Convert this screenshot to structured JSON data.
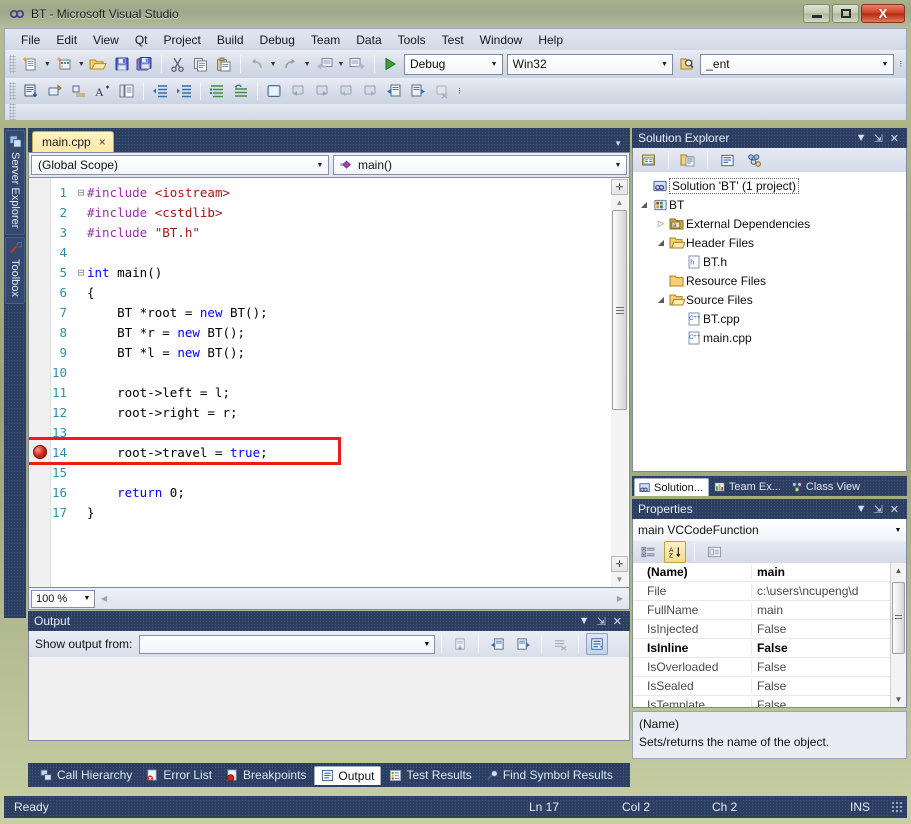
{
  "window": {
    "title": "BT - Microsoft Visual Studio",
    "app_icon": "visual-studio-icon",
    "minimize_label": "Minimize",
    "maximize_label": "Maximize",
    "close_label": "X"
  },
  "menu": {
    "items": [
      {
        "label": "File",
        "accel": "F"
      },
      {
        "label": "Edit",
        "accel": "E"
      },
      {
        "label": "View",
        "accel": "V"
      },
      {
        "label": "Qt",
        "accel": "Q"
      },
      {
        "label": "Project",
        "accel": "P"
      },
      {
        "label": "Build",
        "accel": "B"
      },
      {
        "label": "Debug",
        "accel": "D"
      },
      {
        "label": "Team",
        "accel": "m"
      },
      {
        "label": "Data",
        "accel": "a"
      },
      {
        "label": "Tools",
        "accel": "T"
      },
      {
        "label": "Test",
        "accel": "s"
      },
      {
        "label": "Window",
        "accel": "W"
      },
      {
        "label": "Help",
        "accel": "H"
      }
    ]
  },
  "toolbar": {
    "config_value": "Debug",
    "platform_value": "Win32",
    "find_value": "_ent",
    "start_label": "Start Debugging",
    "buttons": [
      "new-project-icon",
      "add-new-item-icon",
      "open-file-icon",
      "save-icon",
      "save-all-icon",
      "cut-icon",
      "copy-icon",
      "paste-icon",
      "undo-icon",
      "redo-icon",
      "navigate-backward-icon",
      "navigate-forward-icon"
    ],
    "text_editor_buttons": [
      "display-hidden-icon",
      "toggle-word-wrap-icon",
      "toggle-whitespace-icon",
      "font-size-icon",
      "clipboard-ring-icon",
      "decrease-indent-icon",
      "increase-indent-icon",
      "comment-lines-icon",
      "uncomment-lines-icon",
      "toggle-bookmark-icon",
      "previous-bookmark-icon",
      "next-bookmark-icon",
      "previous-bookmark-folder-icon",
      "next-bookmark-folder-icon",
      "move-bookmark-prev-icon",
      "move-bookmark-next-icon",
      "clear-bookmarks-icon"
    ]
  },
  "left_dock": {
    "tabs": [
      {
        "label": "Server Explorer",
        "icon": "server-explorer-icon"
      },
      {
        "label": "Toolbox",
        "icon": "toolbox-icon"
      }
    ]
  },
  "editor": {
    "tab_label": "main.cpp",
    "tab_close": "×",
    "scope_value": "(Global Scope)",
    "function_value": "main()",
    "function_icon": "method-icon",
    "zoom_value": "100 %",
    "breakpoint_line": 14,
    "highlight_line": 14,
    "lines": [
      {
        "n": "1",
        "fold": "−",
        "tokens": [
          {
            "t": "#include ",
            "c": "pre"
          },
          {
            "t": "<iostream>",
            "c": "ang"
          }
        ]
      },
      {
        "n": "2",
        "fold": "",
        "tokens": [
          {
            "t": "#include ",
            "c": "pre"
          },
          {
            "t": "<cstdlib>",
            "c": "ang"
          }
        ]
      },
      {
        "n": "3",
        "fold": "",
        "tokens": [
          {
            "t": "#include ",
            "c": "pre"
          },
          {
            "t": "\"BT.h\"",
            "c": "str"
          }
        ]
      },
      {
        "n": "4",
        "fold": "",
        "tokens": []
      },
      {
        "n": "5",
        "fold": "−",
        "tokens": [
          {
            "t": "int",
            "c": "kw"
          },
          {
            "t": " main()",
            "c": "ctext"
          }
        ]
      },
      {
        "n": "6",
        "fold": "",
        "tokens": [
          {
            "t": "{",
            "c": "ctext"
          }
        ]
      },
      {
        "n": "7",
        "fold": "",
        "tokens": [
          {
            "t": "    BT *root = ",
            "c": "ctext"
          },
          {
            "t": "new",
            "c": "kw"
          },
          {
            "t": " BT();",
            "c": "ctext"
          }
        ]
      },
      {
        "n": "8",
        "fold": "",
        "tokens": [
          {
            "t": "    BT *r = ",
            "c": "ctext"
          },
          {
            "t": "new",
            "c": "kw"
          },
          {
            "t": " BT();",
            "c": "ctext"
          }
        ]
      },
      {
        "n": "9",
        "fold": "",
        "tokens": [
          {
            "t": "    BT *l = ",
            "c": "ctext"
          },
          {
            "t": "new",
            "c": "kw"
          },
          {
            "t": " BT();",
            "c": "ctext"
          }
        ]
      },
      {
        "n": "10",
        "fold": "",
        "tokens": []
      },
      {
        "n": "11",
        "fold": "",
        "tokens": [
          {
            "t": "    root->left = l;",
            "c": "ctext"
          }
        ]
      },
      {
        "n": "12",
        "fold": "",
        "tokens": [
          {
            "t": "    root->right = r;",
            "c": "ctext"
          }
        ]
      },
      {
        "n": "13",
        "fold": "",
        "tokens": []
      },
      {
        "n": "14",
        "fold": "",
        "tokens": [
          {
            "t": "    root->travel = ",
            "c": "ctext"
          },
          {
            "t": "true",
            "c": "kw"
          },
          {
            "t": ";",
            "c": "ctext"
          }
        ]
      },
      {
        "n": "15",
        "fold": "",
        "tokens": []
      },
      {
        "n": "16",
        "fold": "",
        "tokens": [
          {
            "t": "    ",
            "c": "ctext"
          },
          {
            "t": "return",
            "c": "kw"
          },
          {
            "t": " 0;",
            "c": "ctext"
          }
        ]
      },
      {
        "n": "17",
        "fold": "",
        "tokens": [
          {
            "t": "}",
            "c": "ctext"
          }
        ]
      }
    ]
  },
  "output": {
    "title": "Output",
    "show_output_from_label": "Show output from:",
    "show_output_from_value": "",
    "body_text": "",
    "toolbar_buttons": [
      "find-message-icon",
      "go-to-previous-icon",
      "go-to-next-icon",
      "clear-all-icon",
      "toggle-word-wrap-icon"
    ],
    "tabs": [
      {
        "label": "Call Hierarchy",
        "icon": "call-hierarchy-icon",
        "active": false
      },
      {
        "label": "Error List",
        "icon": "error-list-icon",
        "active": false
      },
      {
        "label": "Breakpoints",
        "icon": "breakpoints-icon",
        "active": false
      },
      {
        "label": "Output",
        "icon": "output-icon",
        "active": true
      },
      {
        "label": "Test Results",
        "icon": "test-results-icon",
        "active": false
      },
      {
        "label": "Find Symbol Results",
        "icon": "find-symbol-results-icon",
        "active": false
      }
    ]
  },
  "solution_explorer": {
    "title": "Solution Explorer",
    "toolbar_buttons": [
      "properties-window-icon",
      "show-all-files-icon",
      "view-code-icon",
      "view-class-diagram-icon"
    ],
    "tree": [
      {
        "depth": 0,
        "arrow": "",
        "icon": "solution-icon",
        "label": "Solution 'BT' (1 project)",
        "selected": true
      },
      {
        "depth": 0,
        "arrow": "◢",
        "icon": "project-icon",
        "label": "BT",
        "selected": false
      },
      {
        "depth": 1,
        "arrow": "▷",
        "icon": "folder-ext-icon",
        "label": "External Dependencies",
        "selected": false
      },
      {
        "depth": 1,
        "arrow": "◢",
        "icon": "folder-open-icon",
        "label": "Header Files",
        "selected": false
      },
      {
        "depth": 2,
        "arrow": "",
        "icon": "header-file-icon",
        "label": "BT.h",
        "selected": false
      },
      {
        "depth": 1,
        "arrow": "",
        "icon": "folder-icon",
        "label": "Resource Files",
        "selected": false
      },
      {
        "depth": 1,
        "arrow": "◢",
        "icon": "folder-open-icon",
        "label": "Source Files",
        "selected": false
      },
      {
        "depth": 2,
        "arrow": "",
        "icon": "cpp-file-icon",
        "label": "BT.cpp",
        "selected": false
      },
      {
        "depth": 2,
        "arrow": "",
        "icon": "cpp-file-icon",
        "label": "main.cpp",
        "selected": false
      }
    ],
    "tabs": [
      {
        "label": "Solution...",
        "icon": "solution-explorer-icon",
        "active": true
      },
      {
        "label": "Team Ex...",
        "icon": "team-explorer-icon",
        "active": false
      },
      {
        "label": "Class View",
        "icon": "class-view-icon",
        "active": false
      }
    ]
  },
  "properties": {
    "title": "Properties",
    "object_value": "main VCCodeFunction",
    "toolbar_buttons": [
      "categorized-icon",
      "alphabetical-icon",
      "property-pages-icon"
    ],
    "rows": [
      {
        "key": "(Name)",
        "value": "main",
        "bold": true
      },
      {
        "key": "File",
        "value": "c:\\users\\ncupeng\\d",
        "bold": false
      },
      {
        "key": "FullName",
        "value": "main",
        "bold": false
      },
      {
        "key": "IsInjected",
        "value": "False",
        "bold": false
      },
      {
        "key": "IsInline",
        "value": "False",
        "bold": true
      },
      {
        "key": "IsOverloaded",
        "value": "False",
        "bold": false
      },
      {
        "key": "IsSealed",
        "value": "False",
        "bold": false
      },
      {
        "key": "IsTemplate",
        "value": "False",
        "bold": false
      }
    ],
    "description_title": "(Name)",
    "description_text": "Sets/returns the name of the object."
  },
  "status": {
    "ready": "Ready",
    "ln": "Ln 17",
    "col": "Col 2",
    "ch": "Ch 2",
    "ins": "INS"
  },
  "colors": {
    "chrome": "#2c3f63",
    "accent_tab": "#ffe9a8",
    "highlight_box": "#ee1b1b",
    "breakpoint": "#d0281c",
    "keyword": "#0000ff",
    "preprocessor": "#9b30b0",
    "string": "#a31515",
    "line_number": "#2b91af"
  }
}
